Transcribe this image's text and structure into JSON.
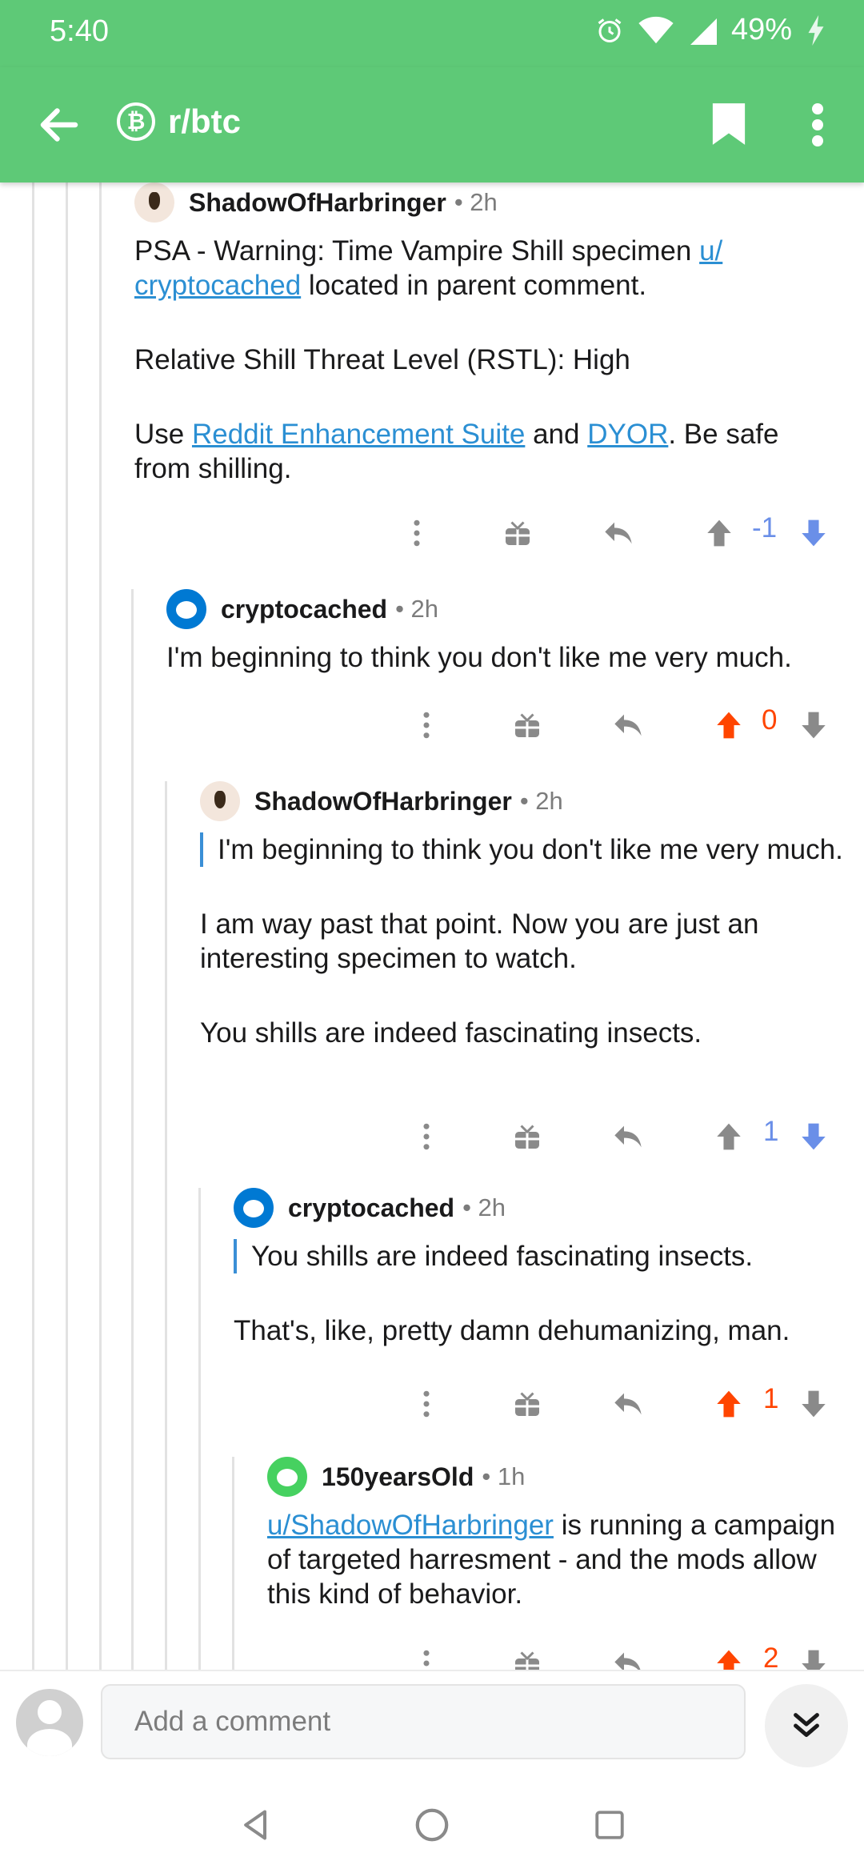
{
  "status_bar": {
    "time": "5:40",
    "battery": "49%"
  },
  "toolbar": {
    "subreddit": "r/btc"
  },
  "comments": [
    {
      "author": "ShadowOfHarbringer",
      "meta": "• 2h",
      "p1_a": "PSA - Warning: Time Vampire Shill specimen ",
      "p1_link": "u/ cryptocached",
      "p1_b": " located in parent comment.",
      "p2": "Relative Shill Threat Level (RSTL): High",
      "p3_a": "Use ",
      "p3_link1": "Reddit Enhancement Suite",
      "p3_b": " and ",
      "p3_link2": "DYOR",
      "p3_c": ". Be safe from shilling.",
      "score": "-1"
    },
    {
      "author": "cryptocached",
      "meta": "• 2h",
      "p1": "I'm beginning to think you don't like me very much.",
      "score": "0"
    },
    {
      "author": "ShadowOfHarbringer",
      "meta": "• 2h",
      "quote": "I'm beginning to think you don't like me very much.",
      "p1": "I am way past that point. Now you are just an interesting specimen to watch.",
      "p2": "You shills are indeed fascinating insects.",
      "score": "1"
    },
    {
      "author": "cryptocached",
      "meta": "• 2h",
      "quote": "You shills are indeed fascinating insects.",
      "p1": "That's, like, pretty damn dehumanizing, man.",
      "score": "1"
    },
    {
      "author": "150yearsOld",
      "meta": "• 1h",
      "p1_link": "u/ShadowOfHarbringer",
      "p1_b": " is running a campaign of targeted harresment - and the mods allow this kind of behavior.",
      "score": "2"
    }
  ],
  "composer": {
    "placeholder": "Add a comment"
  },
  "colors": {
    "brand_green": "#5ec977",
    "upvote": "#ff4500",
    "downvote": "#6a8fe8",
    "link": "#2b8fd3"
  }
}
